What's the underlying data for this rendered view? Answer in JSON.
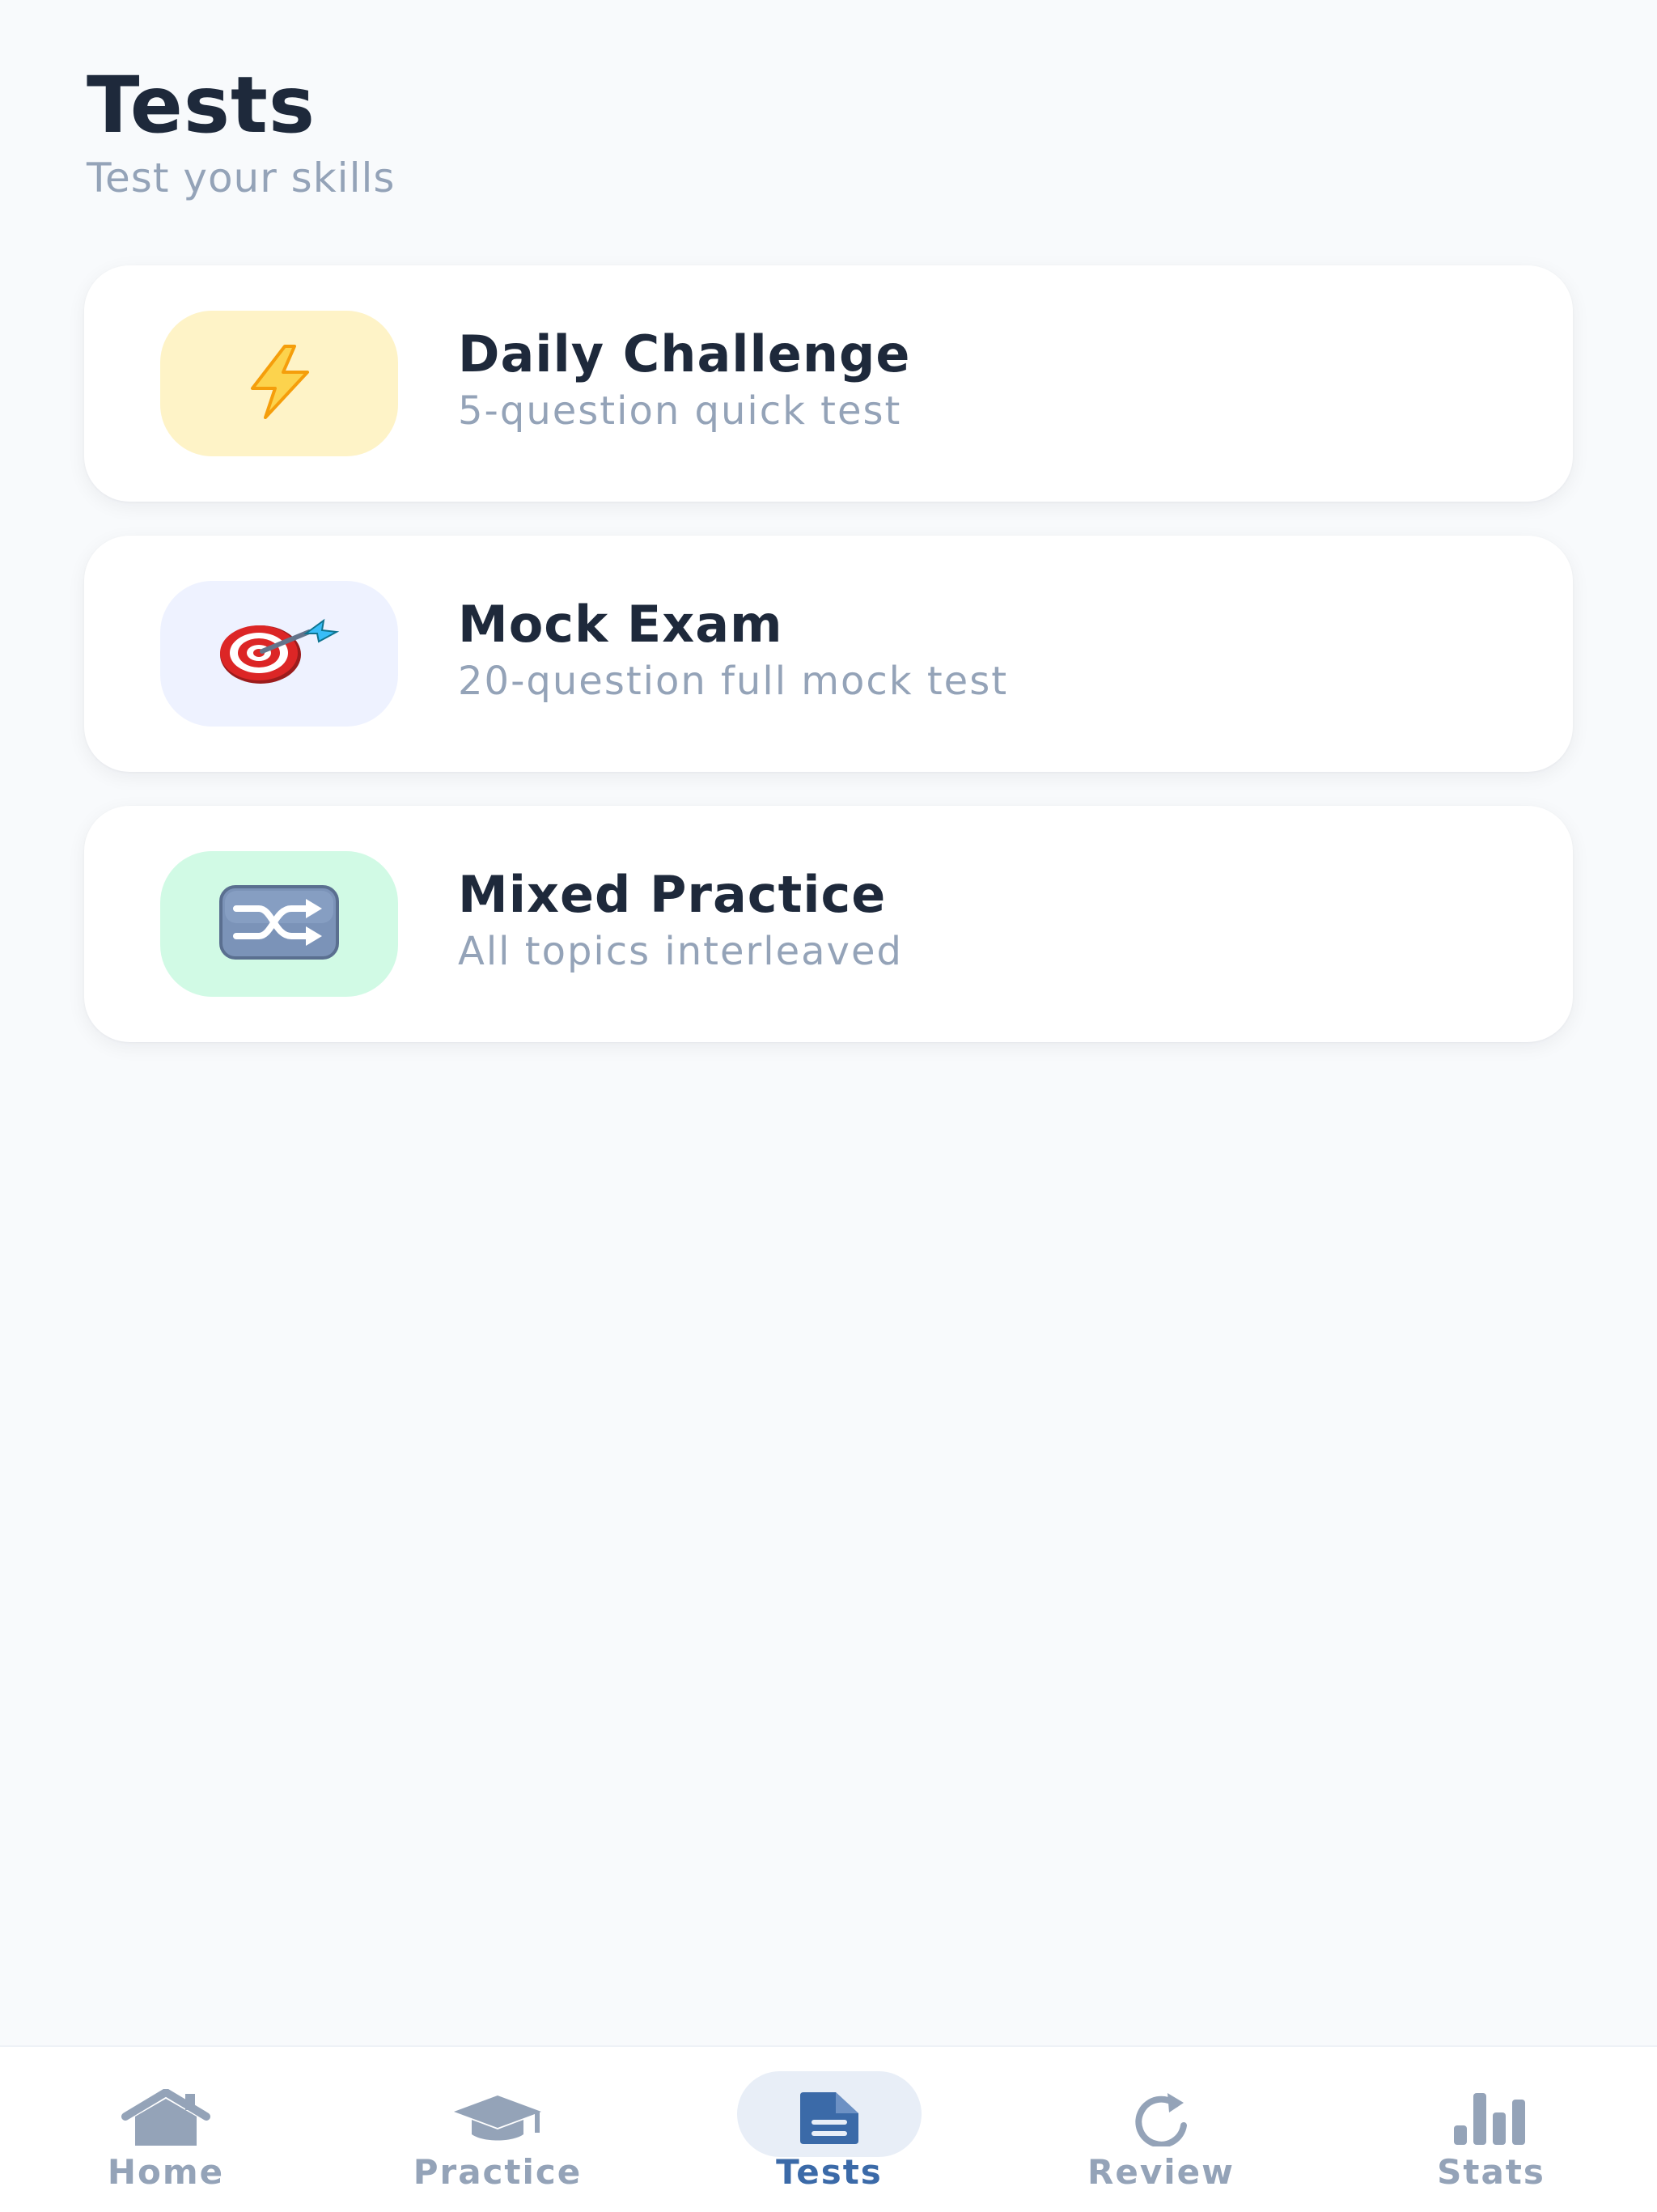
{
  "header": {
    "title": "Tests",
    "subtitle": "Test your skills"
  },
  "cards": [
    {
      "title": "Daily Challenge",
      "subtitle": "5-question quick test",
      "icon": "lightning-icon",
      "icon_bg": "#fef3c7"
    },
    {
      "title": "Mock Exam",
      "subtitle": "20-question full mock test",
      "icon": "target-dart-icon",
      "icon_bg": "#eef2ff"
    },
    {
      "title": "Mixed Practice",
      "subtitle": "All topics interleaved",
      "icon": "shuffle-icon",
      "icon_bg": "#d1fae5"
    }
  ],
  "tabbar": {
    "active": "Tests",
    "tabs": [
      {
        "label": "Home",
        "icon": "home-icon"
      },
      {
        "label": "Practice",
        "icon": "graduation-cap-icon"
      },
      {
        "label": "Tests",
        "icon": "document-icon"
      },
      {
        "label": "Review",
        "icon": "refresh-icon"
      },
      {
        "label": "Stats",
        "icon": "bar-chart-icon"
      }
    ]
  },
  "colors": {
    "background": "#f8fafc",
    "title": "#1e293b",
    "muted": "#94a3b8",
    "accent": "#3b6aa8",
    "active_pill": "#e8eef7"
  }
}
